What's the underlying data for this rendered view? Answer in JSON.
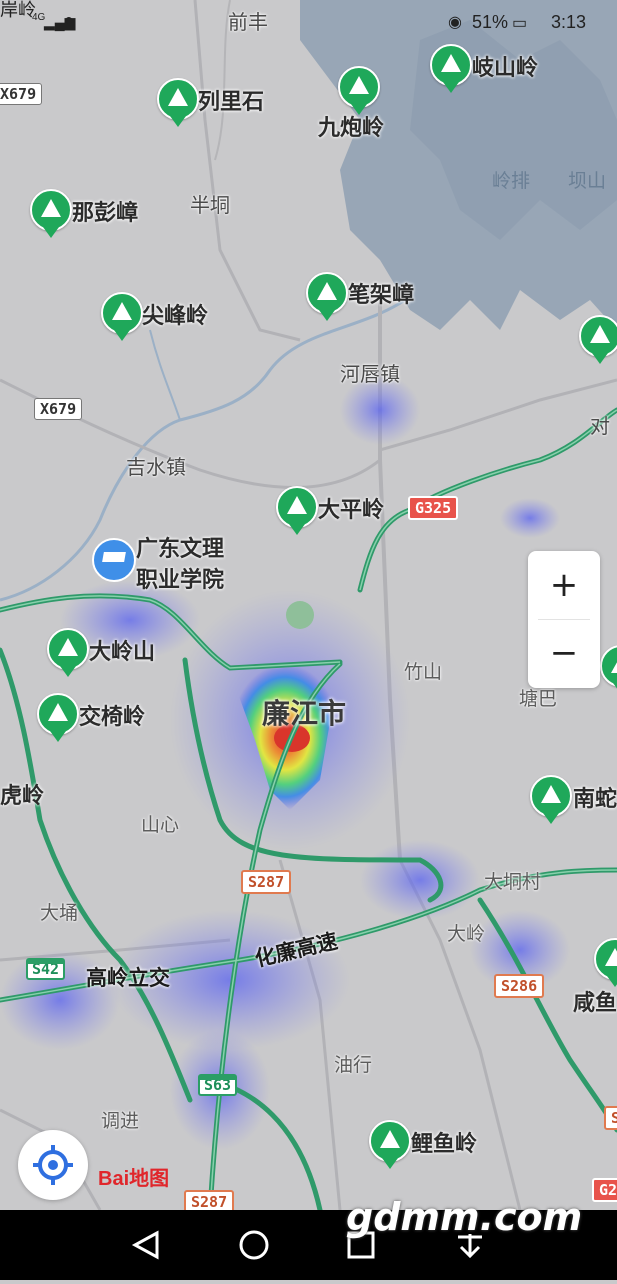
{
  "status_bar": {
    "network": "4G",
    "battery_percent": "51%",
    "time": "3:13"
  },
  "map": {
    "city": "廉江市",
    "places": [
      "前丰",
      "半垌",
      "河唇镇",
      "吉水镇",
      "竹山",
      "塘巴",
      "山心",
      "大埇",
      "大垌村",
      "大岭",
      "油行",
      "调进"
    ],
    "water_labels": [
      "岭排",
      "坝山"
    ],
    "peaks": [
      "岐山岭",
      "列里石",
      "九炮岭",
      "那彭嶂",
      "笔架嶂",
      "尖峰岭",
      "大平岭",
      "大岭山",
      "交椅岭",
      "南蛇",
      "咸鱼",
      "鲤鱼岭"
    ],
    "edge_labels": [
      "岸岭",
      "对",
      "虎岭"
    ],
    "pois": {
      "college_line1": "广东文理",
      "college_line2": "职业学院"
    },
    "highway_names": [
      "化廉高速",
      "高岭立交"
    ],
    "route_shields": {
      "x679_top": "X679",
      "x679": "X679",
      "g325": "G325",
      "s287": "S287",
      "s42": "S42",
      "s286": "S286",
      "s63": "S63",
      "s287_bottom": "S287",
      "g2_partial": "G2",
      "s_partial": "S"
    }
  },
  "zoom": {
    "in_label": "+",
    "out_label": "−"
  },
  "logo": {
    "text": "Bai地图"
  },
  "icons": [
    "eye-icon",
    "battery-icon",
    "wechat-icon",
    "signal-icon",
    "mountain-pin-icon",
    "school-pin-icon",
    "locate-icon",
    "back-icon",
    "home-icon",
    "recents-icon",
    "download-icon"
  ],
  "watermark": "gdmm.com"
}
